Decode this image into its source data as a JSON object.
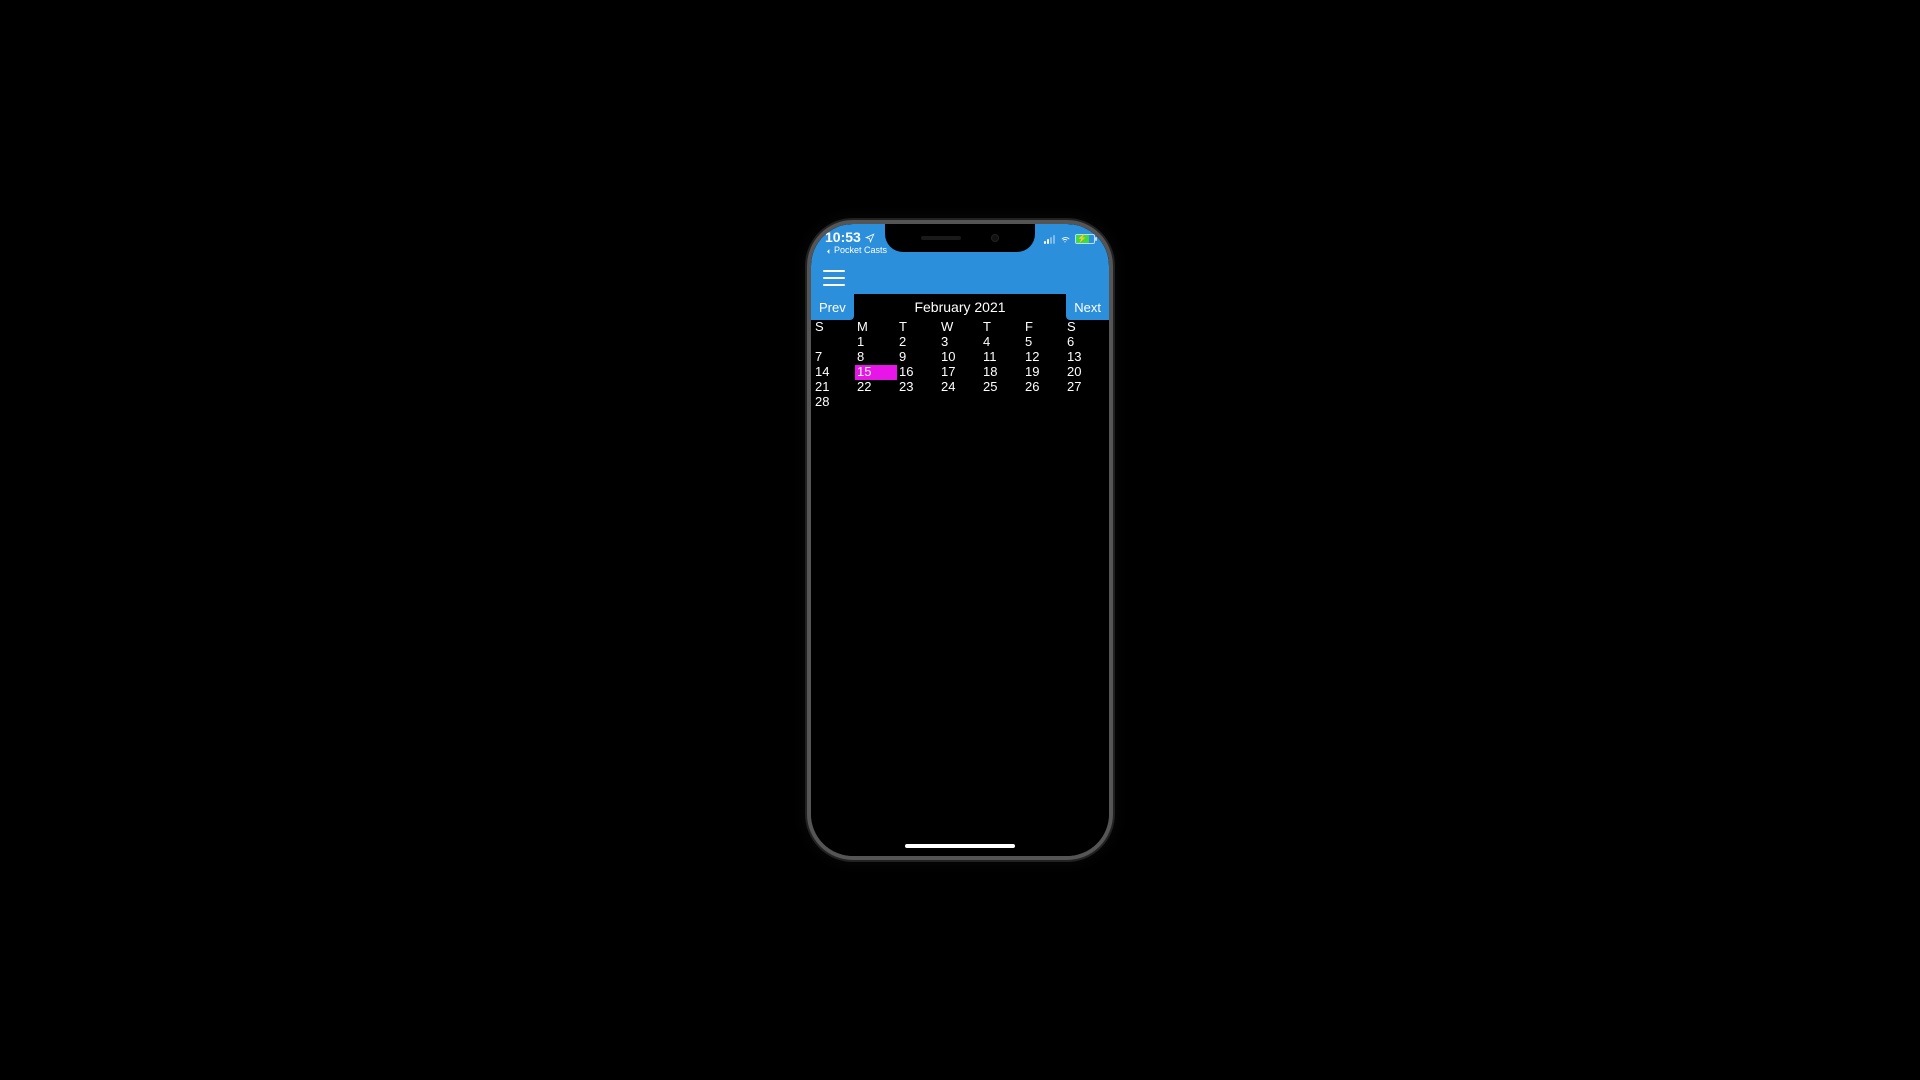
{
  "statusbar": {
    "time": "10:53",
    "back_app": "Pocket Casts"
  },
  "calendar": {
    "title": "February 2021",
    "prev_label": "Prev",
    "next_label": "Next",
    "day_headers": [
      "S",
      "M",
      "T",
      "W",
      "T",
      "F",
      "S"
    ],
    "weeks": [
      [
        "",
        "1",
        "2",
        "3",
        "4",
        "5",
        "6"
      ],
      [
        "7",
        "8",
        "9",
        "10",
        "11",
        "12",
        "13"
      ],
      [
        "14",
        "15",
        "16",
        "17",
        "18",
        "19",
        "20"
      ],
      [
        "21",
        "22",
        "23",
        "24",
        "25",
        "26",
        "27"
      ],
      [
        "28",
        "",
        "",
        "",
        "",
        "",
        ""
      ]
    ],
    "selected_day": "15"
  },
  "colors": {
    "accent": "#2b8fdb",
    "selected": "#e815e8"
  }
}
